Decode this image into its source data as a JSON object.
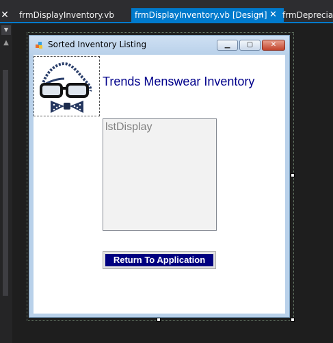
{
  "tabs": [
    {
      "label": "frmDisplayInventory.vb"
    },
    {
      "label": "frmDisplayInventory.vb [Design]",
      "pin_icon": "pin-icon",
      "close_icon": "close-icon"
    },
    {
      "label": "frmDepreciati"
    }
  ],
  "form": {
    "title": "Sorted Inventory Listing",
    "heading": "Trends Menswear Inventory",
    "listbox_name": "lstDisplay",
    "button_label": "Return To Application",
    "picture_icon": "glasses-bowtie-image"
  },
  "colors": {
    "accent": "#007acc",
    "heading": "#00008b",
    "button_bg": "#000080",
    "form_border": "#b9d1ea"
  }
}
